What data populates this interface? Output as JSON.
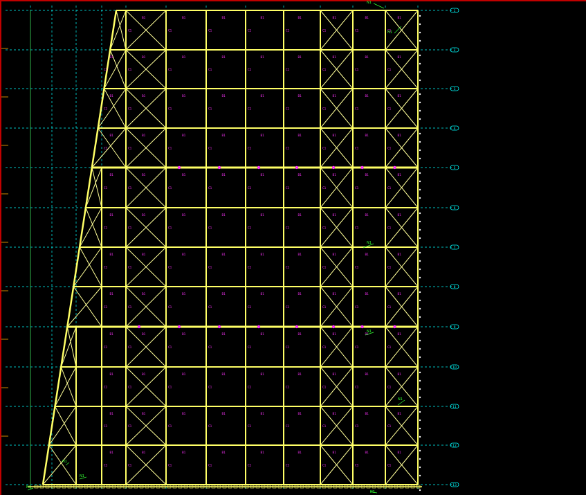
{
  "diagram": {
    "type": "cad-structural-elevation",
    "colors": {
      "background": "#000000",
      "frame": "#ffff66",
      "bracing": "#ffff99",
      "grid": "#00ffff",
      "member_tags": "#ff33ff",
      "annotation": "#33ff33",
      "border": "#c00000"
    },
    "grid_bubbles": [
      "1",
      "2",
      "3",
      "4",
      "5",
      "6",
      "7",
      "8",
      "9",
      "10",
      "11",
      "12",
      "13"
    ],
    "column_tag": "C1",
    "beam_tag": "B1",
    "note_tag": "N1",
    "base_tag": "BP"
  }
}
